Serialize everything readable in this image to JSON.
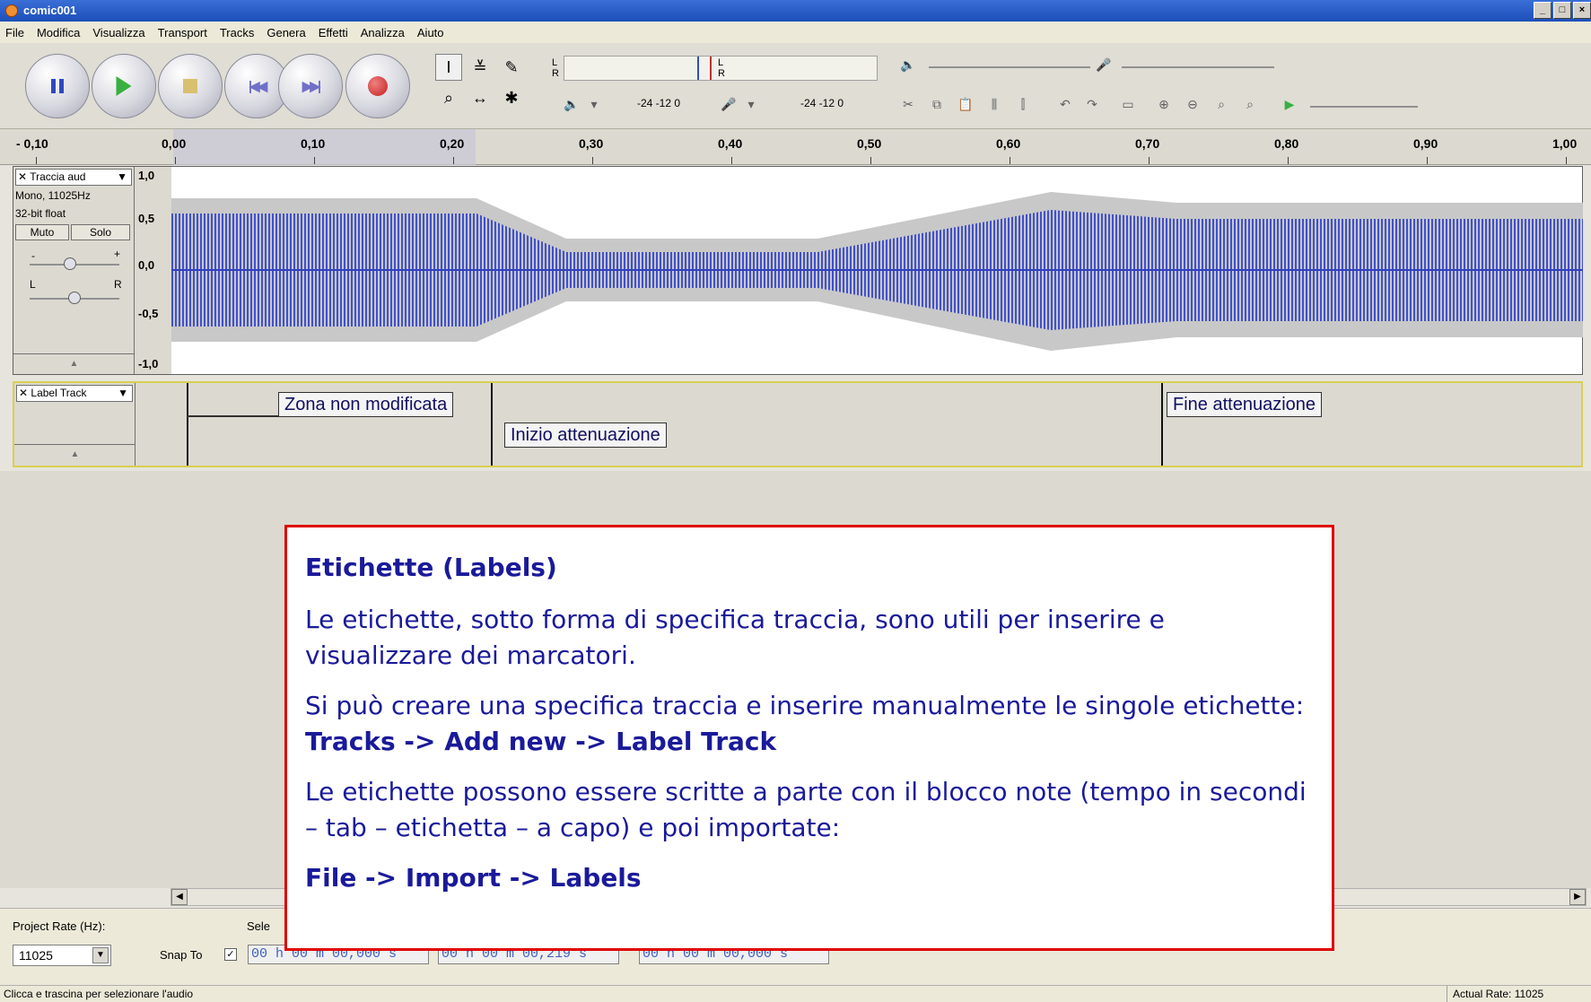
{
  "window": {
    "title": "comic001",
    "buttons": [
      "_",
      "□",
      "×"
    ]
  },
  "menu": [
    "File",
    "Modifica",
    "Visualizza",
    "Transport",
    "Tracks",
    "Genera",
    "Effetti",
    "Analizza",
    "Aiuto"
  ],
  "meters": {
    "l": "L",
    "r": "R",
    "scale_play": "-24  -12  0",
    "scale_rec": "-24  -12  0"
  },
  "ruler": {
    "labels": [
      "- 0,10",
      "0,00",
      "0,10",
      "0,20",
      "0,30",
      "0,40",
      "0,50",
      "0,60",
      "0,70",
      "0,80",
      "0,90",
      "1,00"
    ]
  },
  "audio_track": {
    "name": "Traccia aud",
    "format": "Mono, 11025Hz",
    "bits": "32-bit float",
    "mute": "Muto",
    "solo": "Solo",
    "gain_minus": "-",
    "gain_plus": "+",
    "pan_l": "L",
    "pan_r": "R",
    "scale": [
      "1,0",
      "0,5",
      "0,0",
      "-0,5",
      "-1,0"
    ],
    "collapse": "▲"
  },
  "label_track": {
    "name": "Label Track",
    "collapse": "▲",
    "labels": [
      "Zona non modificata",
      "Inizio attenuazione",
      "Fine attenuazione"
    ]
  },
  "bottom": {
    "project_rate_label": "Project Rate (Hz):",
    "project_rate": "11025",
    "selection_label": "Sele",
    "snap_to": "Snap To",
    "time_start": "00 h 00 m 00,000 s",
    "time_end": "00 h 00 m 00,219 s",
    "time_pos": "00 h 00 m 00,000 s"
  },
  "status": {
    "left": "Clicca e trascina per selezionare l'audio",
    "right": "Actual Rate: 11025"
  },
  "overlay": {
    "title": "Etichette (Labels)",
    "p1": "Le etichette, sotto forma di specifica traccia, sono utili per inserire e visualizzare dei marcatori.",
    "p2": "Si può creare una specifica traccia e inserire manualmente le singole etichette: ",
    "p2_bold": "Tracks -> Add new -> Label Track",
    "p3": "Le etichette possono essere scritte a parte con il blocco note (tempo in secondi – tab – etichetta – a capo) e poi importate:",
    "p4_bold": "File -> Import -> Labels"
  },
  "colors": {
    "wave": "#4050d0",
    "accent_border": "#e00000",
    "overlay_text": "#1a1a9a"
  }
}
